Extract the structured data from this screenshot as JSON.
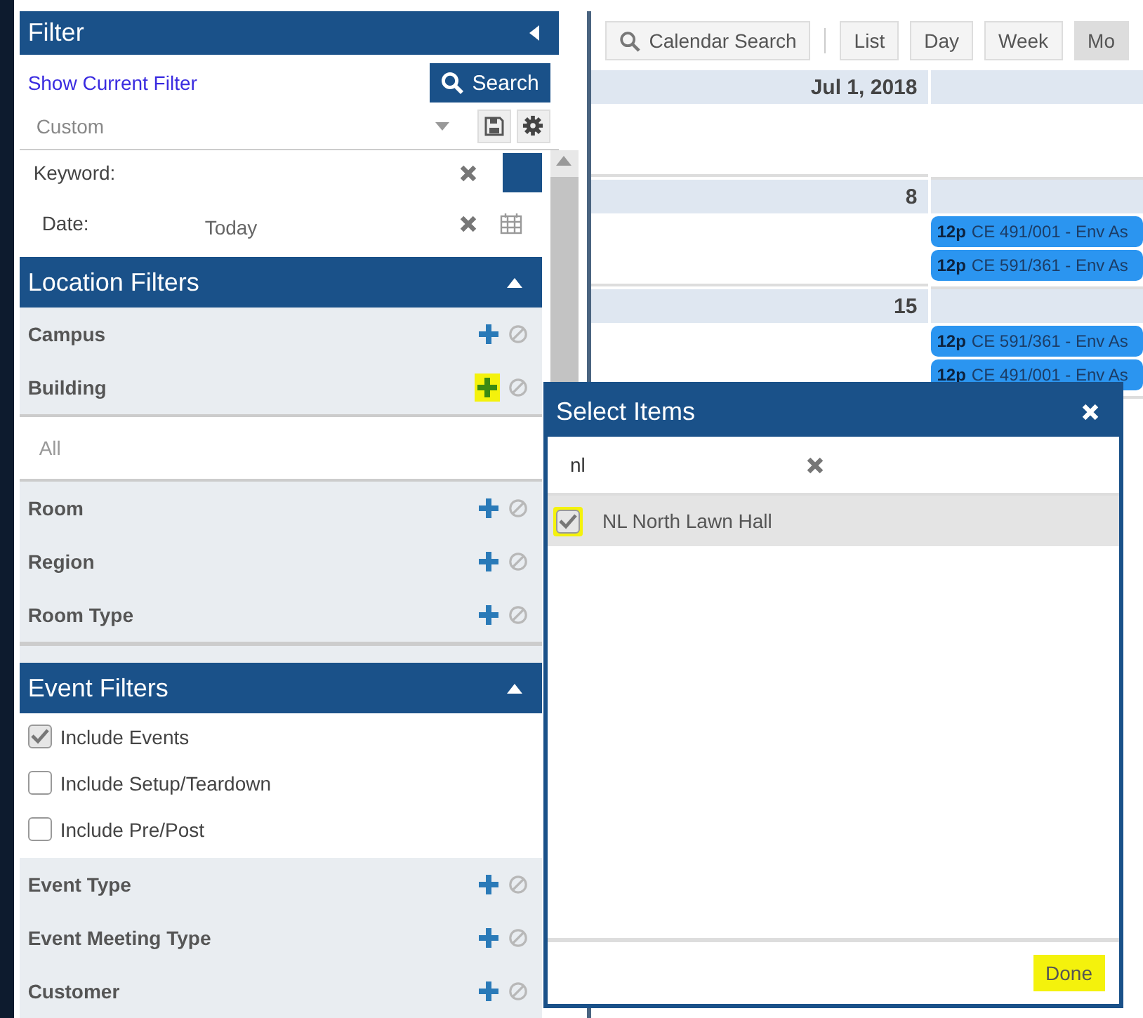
{
  "sidebar": {
    "title": "Filter",
    "show_filter_link": "Show Current Filter",
    "search_button": "Search",
    "saved_filter": "Custom",
    "keyword_label": "Keyword:",
    "date_label": "Date:",
    "date_value": "Today"
  },
  "location_filters": {
    "title": "Location Filters",
    "expanded": true,
    "items": [
      {
        "label": "Campus",
        "highlighted": false
      },
      {
        "label": "Building",
        "highlighted": true,
        "value": "All"
      },
      {
        "label": "Room",
        "highlighted": false
      },
      {
        "label": "Region",
        "highlighted": false
      },
      {
        "label": "Room Type",
        "highlighted": false
      }
    ]
  },
  "event_filters": {
    "title": "Event Filters",
    "expanded": true,
    "checkboxes": [
      {
        "label": "Include Events",
        "checked": true
      },
      {
        "label": "Include Setup/Teardown",
        "checked": false
      },
      {
        "label": "Include Pre/Post",
        "checked": false
      }
    ],
    "items": [
      {
        "label": "Event Type",
        "highlighted": false
      },
      {
        "label": "Event Meeting Type",
        "highlighted": false
      },
      {
        "label": "Customer",
        "highlighted": false
      }
    ]
  },
  "calendar": {
    "search_button": "Calendar Search",
    "views": [
      {
        "label": "List",
        "selected": false
      },
      {
        "label": "Day",
        "selected": false
      },
      {
        "label": "Week",
        "selected": false
      },
      {
        "label": "Mo",
        "selected": true
      }
    ],
    "weeks": [
      {
        "date_label": "Jul 1, 2018"
      },
      {
        "date_label": "8",
        "events": [
          {
            "time": "12p",
            "title": "CE 491/001 - Env As"
          },
          {
            "time": "12p",
            "title": "CE 591/361 - Env As"
          }
        ]
      },
      {
        "date_label": "15",
        "events": [
          {
            "time": "12p",
            "title": "CE 591/361 - Env As"
          },
          {
            "time": "12p",
            "title": "CE 491/001 - Env As"
          }
        ]
      }
    ]
  },
  "dialog": {
    "title": "Select Items",
    "search_value": "nl",
    "items": [
      {
        "label": "NL North Lawn Hall",
        "checked": true,
        "highlighted": true
      }
    ],
    "done_button": {
      "label": "Done",
      "highlighted": true
    }
  }
}
